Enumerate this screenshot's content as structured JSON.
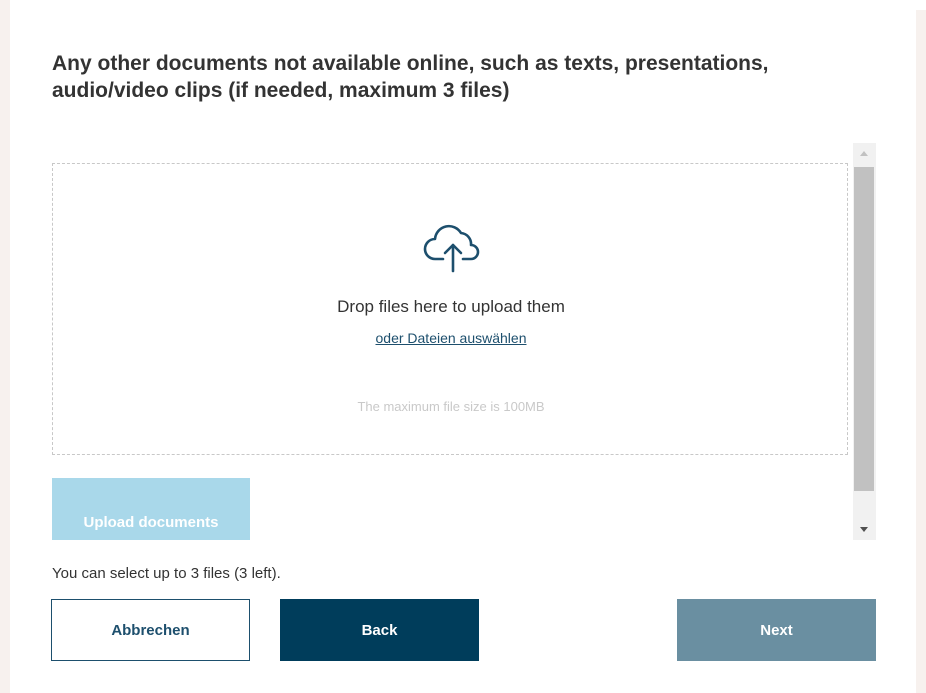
{
  "heading": "Any other documents not available online, such as texts, presentations, audio/video clips (if needed, maximum 3 files)",
  "dropzone": {
    "icon": "cloud-upload-icon",
    "title": "Drop files here to upload them",
    "select_link": "oder Dateien auswählen",
    "max_size": "The maximum file size is 100MB"
  },
  "upload_button": "Upload documents",
  "file_count": "You can select up to 3 files (3 left).",
  "buttons": {
    "cancel": "Abbrechen",
    "back": "Back",
    "next": "Next"
  },
  "colors": {
    "primary": "#003d5b",
    "next_disabled": "#6a8fa1",
    "upload_disabled": "#a9d8ea",
    "link": "#1d4f6d"
  }
}
